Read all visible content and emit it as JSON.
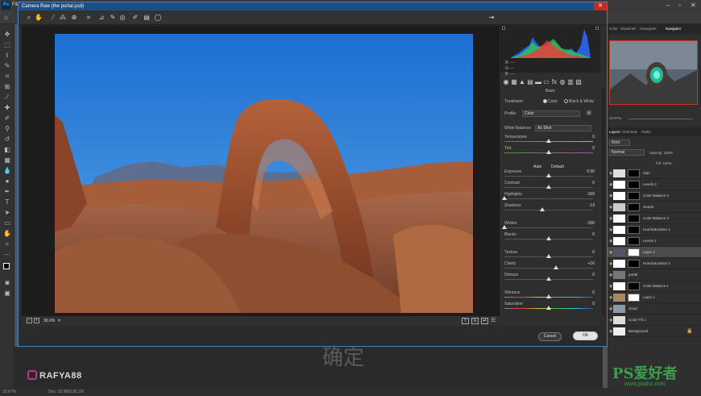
{
  "app": {
    "menu_first": "File"
  },
  "dialog": {
    "title": "Camera Raw (the portal.psd)",
    "close": "✕",
    "zoom": "36.6%",
    "cancel_label": "Cancel",
    "ok_label": "OK"
  },
  "histogram": {
    "r": "R: ---",
    "g": "G: ---",
    "b": "B: ---"
  },
  "basic": {
    "panel_title": "Basic",
    "treatment_label": "Treatment:",
    "treatment_color": "Color",
    "treatment_bw": "Black & White",
    "profile_label": "Profile:",
    "profile_value": "Color",
    "wb_label": "White Balance:",
    "wb_value": "As Shot",
    "auto_label": "Auto",
    "default_label": "Default",
    "sliders": [
      {
        "label": "Temperature",
        "value": "0",
        "pos": 0.5
      },
      {
        "label": "Tint",
        "value": "0",
        "pos": 0.5
      },
      {
        "label": "Exposure",
        "value": "0.00",
        "pos": 0.5
      },
      {
        "label": "Contrast",
        "value": "0",
        "pos": 0.5
      },
      {
        "label": "Highlights",
        "value": "-100",
        "pos": 0.0
      },
      {
        "label": "Shadows",
        "value": "-13",
        "pos": 0.43
      },
      {
        "label": "Whites",
        "value": "-100",
        "pos": 0.0
      },
      {
        "label": "Blacks",
        "value": "0",
        "pos": 0.5
      },
      {
        "label": "Texture",
        "value": "0",
        "pos": 0.5
      },
      {
        "label": "Clarity",
        "value": "+16",
        "pos": 0.58
      },
      {
        "label": "Dehaze",
        "value": "0",
        "pos": 0.5
      },
      {
        "label": "Vibrance",
        "value": "0",
        "pos": 0.5
      },
      {
        "label": "Saturation",
        "value": "0",
        "pos": 0.5
      }
    ]
  },
  "ps_panels": {
    "tabs": [
      "Color",
      "Swatches",
      "Histogram",
      "Navigator"
    ],
    "nav_zoom": "33.67%",
    "layer_tabs": [
      "Layers",
      "Channels",
      "Paths"
    ],
    "kind": "Kind",
    "blend": "Normal",
    "opacity": "Opacity: 100%",
    "fill": "Fill: 100%",
    "layers": [
      {
        "name": "man"
      },
      {
        "name": "Levels 2"
      },
      {
        "name": "Color Balance 2"
      },
      {
        "name": "clouds"
      },
      {
        "name": "Color Balance 3"
      },
      {
        "name": "Hue/Saturation 1"
      },
      {
        "name": "Levels 1"
      },
      {
        "name": "Layer 2"
      },
      {
        "name": "Hue/Saturation 2"
      },
      {
        "name": "portal"
      },
      {
        "name": "Color Balance 1"
      },
      {
        "name": "Layer 1"
      },
      {
        "name": "cloud"
      },
      {
        "name": "Color Fill 1"
      },
      {
        "name": "Background"
      }
    ]
  },
  "overlay": {
    "ghost_ok": "确定",
    "handle": "RAFYA88",
    "site": "PS爱好者",
    "site_url": "www.psahz.com"
  },
  "status": {
    "zoom": "33.67%",
    "doc": "Doc: 15.9M/126.1M"
  }
}
